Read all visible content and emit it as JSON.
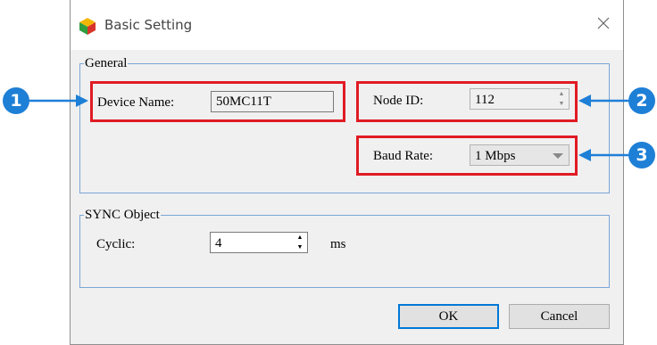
{
  "window": {
    "title": "Basic Setting"
  },
  "general": {
    "legend": "General",
    "device_name_label": "Device Name:",
    "device_name_value": "50MC11T",
    "node_id_label": "Node ID:",
    "node_id_value": "112",
    "baud_rate_label": "Baud Rate:",
    "baud_rate_value": "1 Mbps"
  },
  "sync": {
    "legend": "SYNC Object",
    "cyclic_label": "Cyclic:",
    "cyclic_value": "4",
    "cyclic_unit": "ms"
  },
  "buttons": {
    "ok": "OK",
    "cancel": "Cancel"
  },
  "callouts": [
    "1",
    "2",
    "3"
  ],
  "colors": {
    "highlight": "#e01b24",
    "callout": "#1e7fd6",
    "group_border": "#7aa6d6"
  },
  "icons": {
    "app": "cube-icon",
    "close": "close-icon"
  }
}
